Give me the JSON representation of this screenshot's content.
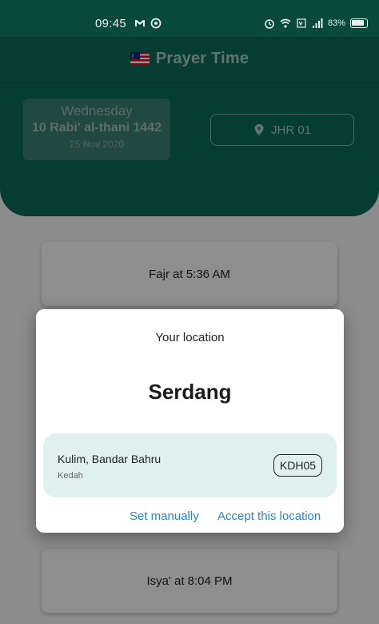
{
  "status_bar": {
    "time": "09:45",
    "battery_pct": "83%",
    "icons": [
      "gmail-icon",
      "sync-icon",
      "alarm-icon",
      "wifi-icon",
      "volte-icon",
      "signal-icon",
      "battery-icon"
    ]
  },
  "header": {
    "title": "Prayer Time",
    "flag": "malaysia-flag",
    "date": {
      "weekday": "Wednesday",
      "hijri": "10 Rabi' al-thani 1442",
      "gregorian": "25 Nov 2020"
    },
    "zone_button": {
      "label": "JHR 01",
      "icon": "location-pin-icon"
    }
  },
  "prayers": {
    "fajr": "Fajr at 5:36 AM",
    "isya": "Isya' at 8:04 PM"
  },
  "dialog": {
    "title": "Your location",
    "city": "Serdang",
    "location": {
      "name": "Kulim, Bandar Bahru",
      "state": "Kedah",
      "zone": "KDH05"
    },
    "actions": {
      "set_manually": "Set manually",
      "accept": "Accept this location"
    },
    "accent_color": "#2a86c8"
  },
  "colors": {
    "primary": "#0b6a58",
    "status_bar": "#0a4a3c",
    "location_box": "#dff0ef"
  }
}
